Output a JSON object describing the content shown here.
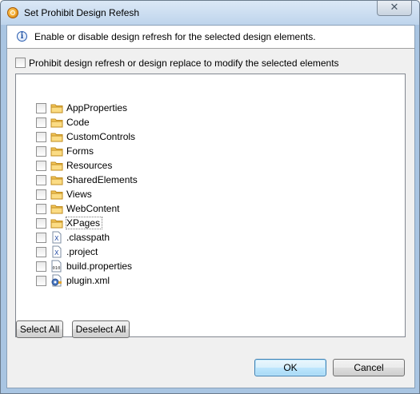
{
  "window": {
    "title": "Set Prohibit Design Refesh",
    "close_glyph": "✕"
  },
  "banner": {
    "icon": "info-icon",
    "text": "Enable or disable design refresh for the selected design elements."
  },
  "prohibit_option": {
    "label": "Prohibit design refresh or design replace to modify the selected elements",
    "checked": false
  },
  "tree": {
    "items": [
      {
        "label": "AppProperties",
        "icon": "folder-icon",
        "checked": false
      },
      {
        "label": "Code",
        "icon": "folder-icon",
        "checked": false
      },
      {
        "label": "CustomControls",
        "icon": "folder-icon",
        "checked": false
      },
      {
        "label": "Forms",
        "icon": "folder-icon",
        "checked": false
      },
      {
        "label": "Resources",
        "icon": "folder-icon",
        "checked": false
      },
      {
        "label": "SharedElements",
        "icon": "folder-icon",
        "checked": false
      },
      {
        "label": "Views",
        "icon": "folder-icon",
        "checked": false
      },
      {
        "label": "WebContent",
        "icon": "folder-icon",
        "checked": false
      },
      {
        "label": "XPages",
        "icon": "folder-icon",
        "checked": false
      },
      {
        "label": ".classpath",
        "icon": "xml-file-icon",
        "checked": false
      },
      {
        "label": ".project",
        "icon": "xml-file-icon",
        "checked": false
      },
      {
        "label": "build.properties",
        "icon": "properties-file-icon",
        "checked": false
      },
      {
        "label": "plugin.xml",
        "icon": "plugin-file-icon",
        "checked": false
      }
    ]
  },
  "buttons": {
    "select_all": "Select All",
    "deselect_all": "Deselect All",
    "ok": "OK",
    "cancel": "Cancel"
  }
}
